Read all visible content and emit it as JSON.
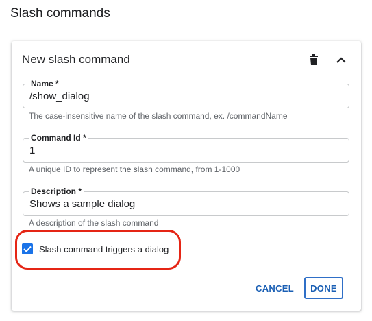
{
  "section": {
    "title": "Slash commands"
  },
  "card": {
    "title": "New slash command",
    "icons": {
      "delete": "trash-icon",
      "collapse": "chevron-up-icon"
    },
    "fields": [
      {
        "label": "Name *",
        "value": "/show_dialog",
        "hint": "The case-insensitive name of the slash command, ex. /commandName"
      },
      {
        "label": "Command Id *",
        "value": "1",
        "hint": "A unique ID to represent the slash command, from 1-1000"
      },
      {
        "label": "Description *",
        "value": "Shows a sample dialog",
        "hint": "A description of the slash command"
      }
    ],
    "checkbox": {
      "label": "Slash command triggers a dialog",
      "checked": true
    },
    "actions": {
      "cancel": "CANCEL",
      "done": "DONE"
    }
  },
  "colors": {
    "accent": "#1a73e8",
    "highlight": "#e52515",
    "button_text": "#1a5fb4"
  }
}
